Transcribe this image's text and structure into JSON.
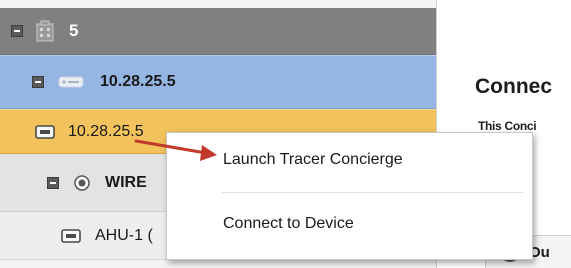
{
  "tree": {
    "site_label": "5",
    "ip_label": "10.28.25.5",
    "selected_label": "10.28.25.5",
    "wire_label": "WIRE",
    "ahu_label": "AHU-1 ("
  },
  "main": {
    "title": "Connec",
    "subtitle": "This Conci",
    "panel_label": "Ou"
  },
  "context_menu": {
    "items": [
      {
        "label": "Launch Tracer Concierge"
      },
      {
        "label": "Connect to Device"
      }
    ]
  },
  "colors": {
    "site_row": "#808080",
    "ip_row": "#95b6e3",
    "selected_row": "#f2c25c",
    "arrow": "#c0392b"
  },
  "icons": [
    "collapse-icon",
    "building-icon",
    "server-icon",
    "device-icon",
    "gear-icon",
    "chevron-down-icon",
    "pointer-arrow"
  ]
}
